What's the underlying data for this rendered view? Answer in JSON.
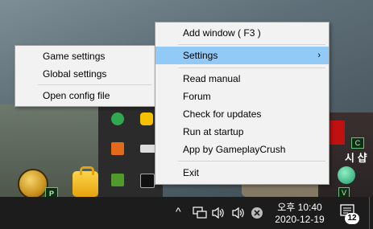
{
  "main_menu": {
    "items": [
      {
        "label": "Add window ( F3 )"
      },
      {
        "label": "Settings",
        "submenu_arrow": "›"
      },
      {
        "label": "Read manual"
      },
      {
        "label": "Forum"
      },
      {
        "label": "Check for updates"
      },
      {
        "label": "Run at startup"
      },
      {
        "label": "App by GameplayCrush"
      },
      {
        "label": "Exit"
      }
    ]
  },
  "settings_submenu": {
    "items": [
      {
        "label": "Game settings"
      },
      {
        "label": "Global settings"
      },
      {
        "label": "Open config file"
      }
    ]
  },
  "desktop": {
    "coin_badge": "P",
    "kor_badge": "C",
    "c_badge": "C",
    "kor_text": "시 샵",
    "v_badge": "V"
  },
  "taskbar": {
    "overflow_chevron": "^",
    "clock_time": "오후 10:40",
    "clock_date": "2020-12-19",
    "notification_count": "12"
  },
  "colors": {
    "menu_bg": "#f2f2f2",
    "menu_highlight": "#91c9f7",
    "taskbar_bg": "#1c1c1c"
  }
}
